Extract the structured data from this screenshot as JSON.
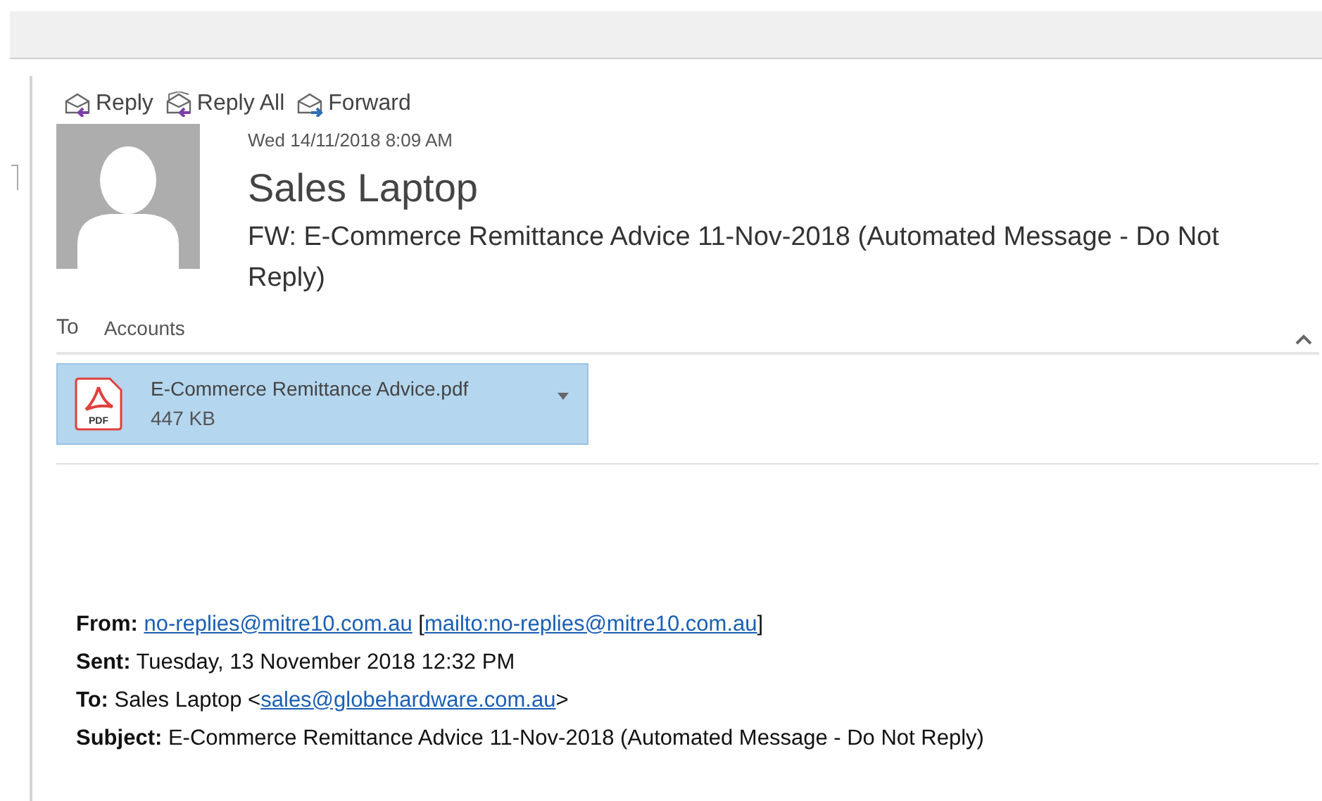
{
  "actions": [
    {
      "label": "Reply",
      "kind": "reply"
    },
    {
      "label": "Reply All",
      "kind": "reply_all"
    },
    {
      "label": "Forward",
      "kind": "forward"
    }
  ],
  "message": {
    "date": "Wed 14/11/2018 8:09 AM",
    "sender": "Sales Laptop",
    "subject": "FW: E-Commerce Remittance Advice 11-Nov-2018 (Automated Message - Do Not Reply)",
    "to_label": "To",
    "to": "Accounts",
    "expanded": true
  },
  "attachment": {
    "name": "E-Commerce Remittance Advice.pdf",
    "size": "447 KB",
    "icon_text": "PDF",
    "selected": true
  },
  "body": [
    {
      "label": "From:",
      "parts": [
        {
          "kind": "link",
          "text": "no-replies@mitre10.com.au"
        },
        {
          "kind": "plain",
          "text": " ["
        },
        {
          "kind": "link",
          "text": "mailto:no-replies@mitre10.com.au"
        },
        {
          "kind": "plain",
          "text": "]"
        }
      ]
    },
    {
      "label": "Sent:",
      "parts": [
        {
          "kind": "plain",
          "text": "Tuesday, 13 November 2018 12:32 PM"
        }
      ]
    },
    {
      "label": "To:",
      "parts": [
        {
          "kind": "plain",
          "text": "Sales Laptop <"
        },
        {
          "kind": "link",
          "text": "sales@globehardware.com.au"
        },
        {
          "kind": "plain",
          "text": ">"
        }
      ]
    },
    {
      "label": "Subject:",
      "parts": [
        {
          "kind": "plain",
          "text": "E-Commerce Remittance Advice 11-Nov-2018 (Automated Message - Do Not Reply)"
        }
      ]
    }
  ]
}
